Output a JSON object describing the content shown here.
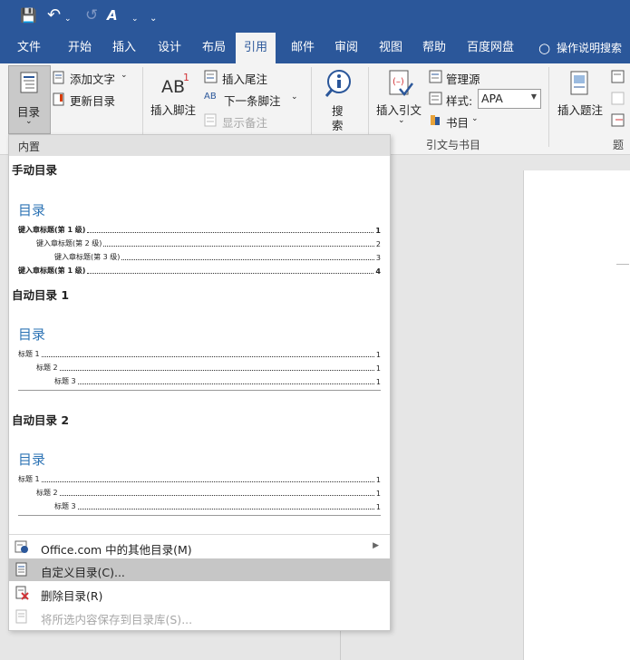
{
  "qat": {
    "save": "💾",
    "undo": "↶",
    "redo": "↺",
    "format": "A",
    "more": "⌄"
  },
  "tabs": [
    {
      "label": "文件"
    },
    {
      "label": "开始"
    },
    {
      "label": "插入"
    },
    {
      "label": "设计"
    },
    {
      "label": "布局"
    },
    {
      "label": "引用"
    },
    {
      "label": "邮件"
    },
    {
      "label": "审阅"
    },
    {
      "label": "视图"
    },
    {
      "label": "帮助"
    },
    {
      "label": "百度网盘"
    }
  ],
  "tellme": "操作说明搜索",
  "ribbon": {
    "toc_label": "目录",
    "add_text": "添加文字",
    "update_toc": "更新目录",
    "insert_footnote": "插入脚注",
    "insert_endnote": "插入尾注",
    "next_footnote": "下一条脚注",
    "show_notes": "显示备注",
    "search_label_1": "搜",
    "search_label_2": "索",
    "insert_citation": "插入引文",
    "manage_sources": "管理源",
    "style_label": "样式:",
    "style_value": "APA",
    "bibliography": "书目",
    "group_citations": "引文与书目",
    "insert_caption": "插入题注",
    "group_captions": "题"
  },
  "menu": {
    "section": "内置",
    "manual": {
      "title": "手动目录",
      "heading": "目录",
      "entries": [
        {
          "label": "键入章标题(第 1 级)",
          "num": "1"
        },
        {
          "label": "键入章标题(第 2 级)",
          "num": "2"
        },
        {
          "label": "键入章标题(第 3 级)",
          "num": "3"
        },
        {
          "label": "键入章标题(第 1 级)",
          "num": "4"
        }
      ]
    },
    "auto1": {
      "title": "自动目录 1",
      "heading": "目录",
      "entries": [
        {
          "label": "标题 1",
          "num": "1"
        },
        {
          "label": "标题 2",
          "num": "1"
        },
        {
          "label": "标题 3",
          "num": "1"
        }
      ]
    },
    "auto2": {
      "title": "自动目录 2",
      "heading": "目录",
      "entries": [
        {
          "label": "标题 1",
          "num": "1"
        },
        {
          "label": "标题 2",
          "num": "1"
        },
        {
          "label": "标题 3",
          "num": "1"
        }
      ]
    },
    "items": [
      {
        "label": "Office.com 中的其他目录(M)"
      },
      {
        "label": "自定义目录(C)..."
      },
      {
        "label": "删除目录(R)"
      },
      {
        "label": "将所选内容保存到目录库(S)..."
      }
    ]
  }
}
